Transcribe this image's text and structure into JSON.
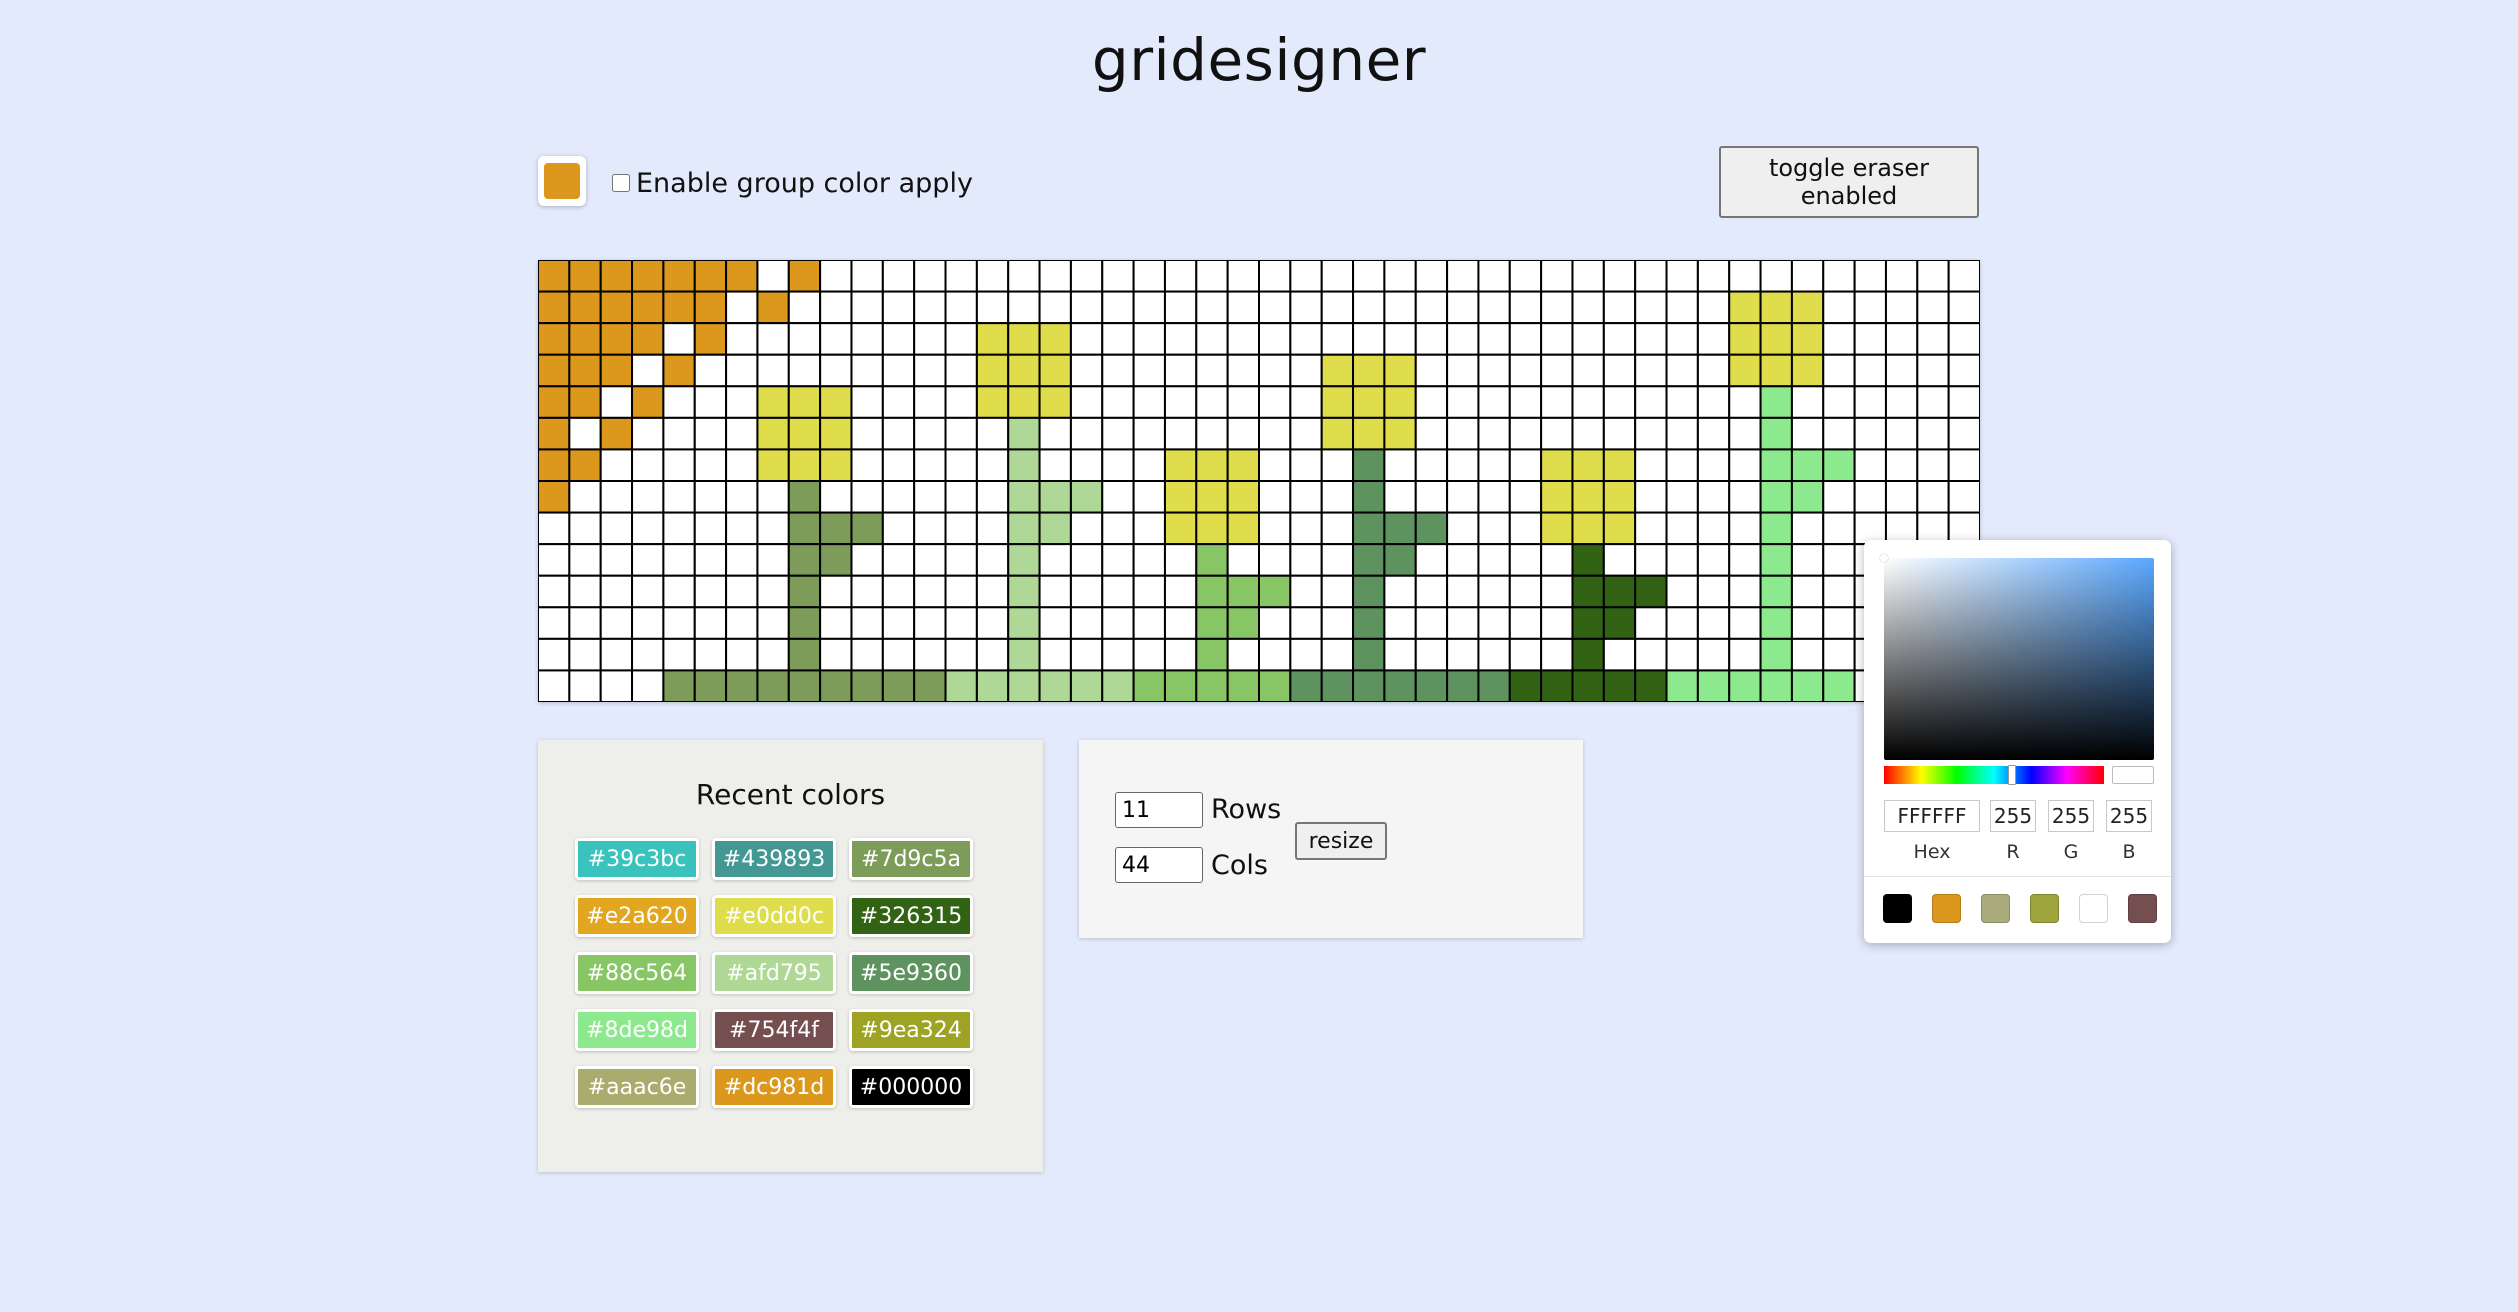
{
  "app": {
    "title": "gridesigner"
  },
  "toolbar": {
    "current_color": "#dc981d",
    "group_apply_label": "Enable group color apply",
    "group_apply_checked": false,
    "eraser_button_label": "toggle eraser enabled"
  },
  "grid": {
    "rows": 14,
    "cols": 46,
    "legend": {
      "o": "#dc981d",
      "y": "#e0dd4c",
      "m": "#7d9c5a",
      "l": "#afd795",
      "a": "#88c564",
      "s": "#5e9360",
      "d": "#326315",
      "n": "#8de98d"
    },
    "cells": [
      "ooooooo.o.....................................",
      "oooooo.o.....................................yyy",
      "oooo.o..............................................",
      "",
      "",
      "",
      "",
      "",
      "",
      "",
      "",
      "",
      "",
      ""
    ]
  },
  "recent_colors": {
    "title": "Recent colors",
    "colors": [
      {
        "label": "#39c3bc",
        "color": "#39c3bc"
      },
      {
        "label": "#439893",
        "color": "#439893"
      },
      {
        "label": "#7d9c5a",
        "color": "#7d9c5a"
      },
      {
        "label": "#e2a620",
        "color": "#e2a620"
      },
      {
        "label": "#e0dd0c",
        "color": "#e0dd4c"
      },
      {
        "label": "#326315",
        "color": "#326315"
      },
      {
        "label": "#88c564",
        "color": "#88c564"
      },
      {
        "label": "#afd795",
        "color": "#afd795"
      },
      {
        "label": "#5e9360",
        "color": "#5e9360"
      },
      {
        "label": "#8de98d",
        "color": "#8de98d"
      },
      {
        "label": "#754f4f",
        "color": "#754f4f"
      },
      {
        "label": "#9ea324",
        "color": "#9ea324"
      },
      {
        "label": "#aaac6e",
        "color": "#aaac6e"
      },
      {
        "label": "#dc981d",
        "color": "#dc981d"
      },
      {
        "label": "#000000",
        "color": "#000000"
      }
    ]
  },
  "resize": {
    "rows_value": "11",
    "rows_label": "Rows",
    "cols_value": "44",
    "cols_label": "Cols",
    "button_label": "resize"
  },
  "color_picker": {
    "hex": "FFFFFF",
    "r": "255",
    "g": "255",
    "b": "255",
    "hex_label": "Hex",
    "r_label": "R",
    "g_label": "G",
    "b_label": "B",
    "preview_color": "#ffffff",
    "hue_level": 0.58,
    "presets": [
      "#000000",
      "#dc981d",
      "#aaac7e",
      "#9ea33c",
      "#ffffff",
      "#754f4f"
    ]
  }
}
